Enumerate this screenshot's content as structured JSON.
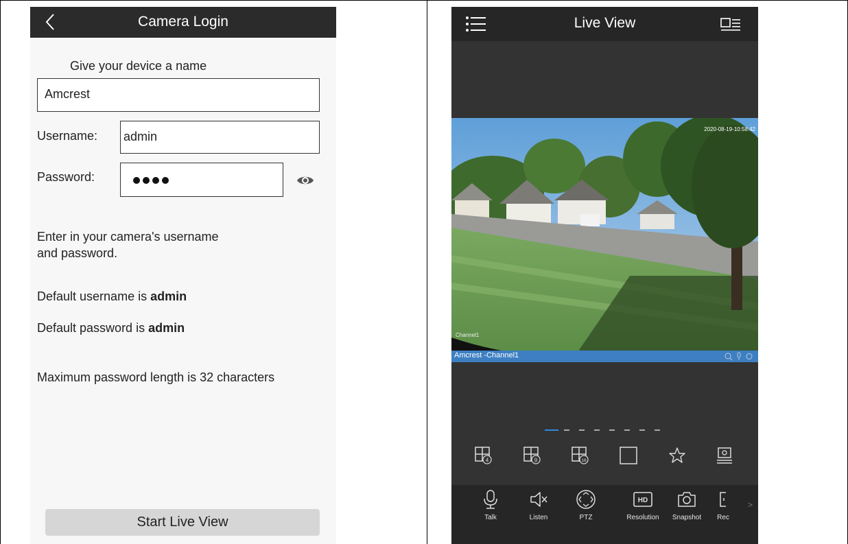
{
  "left": {
    "header": {
      "title": "Camera Login",
      "back_icon": "chevron-left-icon"
    },
    "device_name_label": "Give your device a name",
    "device_name_value": "Amcrest",
    "username_label": "Username:",
    "username_value": "admin",
    "password_label": "Password:",
    "password_icon": "eye-icon",
    "info_line1": "Enter in your camera's username",
    "info_line2": "and password.",
    "default_user_prefix": "Default username is ",
    "default_user_value": "admin",
    "default_pass_prefix": "Default password is ",
    "default_pass_value": "admin",
    "max_length_text": "Maximum password length is 32 characters",
    "start_button": "Start Live View"
  },
  "right": {
    "header": {
      "title": "Live View",
      "menu_icon": "list-menu-icon",
      "device_list_icon": "device-list-icon"
    },
    "video": {
      "timestamp": "2020-08-19-10:58:42",
      "watermark": "Channel1"
    },
    "channel_bar": {
      "name": "Amcrest -Channel1",
      "icons": [
        "zoom-icon",
        "mic-icon",
        "record-icon"
      ]
    },
    "pager": {
      "pages": 8,
      "active": 1
    },
    "layouts": [
      {
        "name": "4-split",
        "badge": "4"
      },
      {
        "name": "9-split",
        "badge": "9"
      },
      {
        "name": "16-split",
        "badge": "16"
      },
      {
        "name": "single",
        "badge": ""
      },
      {
        "name": "favorite",
        "badge": ""
      },
      {
        "name": "device-settings",
        "badge": ""
      }
    ],
    "tools": [
      {
        "label": "Talk",
        "icon": "microphone-icon"
      },
      {
        "label": "Listen",
        "icon": "speaker-mute-icon"
      },
      {
        "label": "PTZ",
        "icon": "ptz-icon"
      },
      {
        "label": "Resolution",
        "icon": "hd-icon",
        "badge": "HD"
      },
      {
        "label": "Snapshot",
        "icon": "camera-icon"
      },
      {
        "label": "Rec",
        "icon": "record-icon"
      }
    ],
    "more_indicator": ">"
  },
  "colors": {
    "left_header_bg": "#2b2b2b",
    "right_bg": "#333333",
    "channel_bar": "#3d7fc2",
    "pager_active": "#2b8be0",
    "start_button_bg": "#d6d6d6"
  }
}
